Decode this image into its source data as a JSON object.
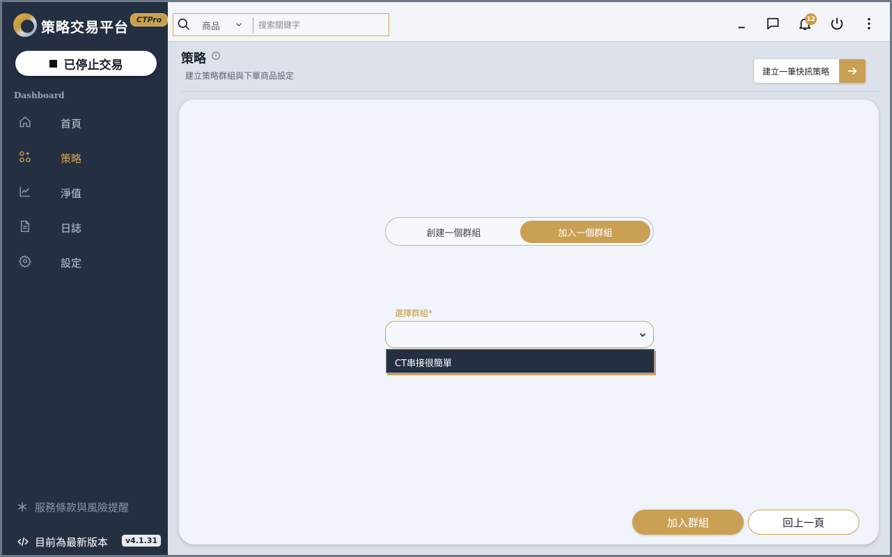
{
  "app": {
    "title": "策略交易平台",
    "edition_badge": "CTPro",
    "trading_status_button": "已停止交易",
    "section_label": "Dashboard"
  },
  "sidebar": {
    "items": [
      {
        "label": "首頁",
        "icon": "home-icon",
        "active": false
      },
      {
        "label": "策略",
        "icon": "strategy-icon",
        "active": true
      },
      {
        "label": "淨值",
        "icon": "chart-line-icon",
        "active": false
      },
      {
        "label": "日誌",
        "icon": "document-icon",
        "active": false
      },
      {
        "label": "設定",
        "icon": "gear-icon",
        "active": false
      }
    ],
    "terms_link": "服務條款與風險提醒",
    "version_text": "目前為最新版本",
    "version_badge": "v4.1.31"
  },
  "topbar": {
    "search_category": "商品",
    "search_placeholder": "搜索關鍵字",
    "notification_count": "12"
  },
  "page": {
    "title": "策略",
    "subtitle": "建立策略群組與下單商品設定",
    "quick_button": "建立一筆快訊策略"
  },
  "form": {
    "toggle_options": [
      "創建一個群組",
      "加入一個群組"
    ],
    "selected_toggle": "加入一個群組",
    "select_label": "選擇群組*",
    "select_value": "",
    "dropdown_options": [
      "CT串接很簡單"
    ],
    "join_button": "加入群組",
    "back_button": "回上一頁"
  },
  "colors": {
    "accent": "#caa054",
    "sidebar_bg": "#242f42",
    "card_bg": "#f1f4fb"
  }
}
